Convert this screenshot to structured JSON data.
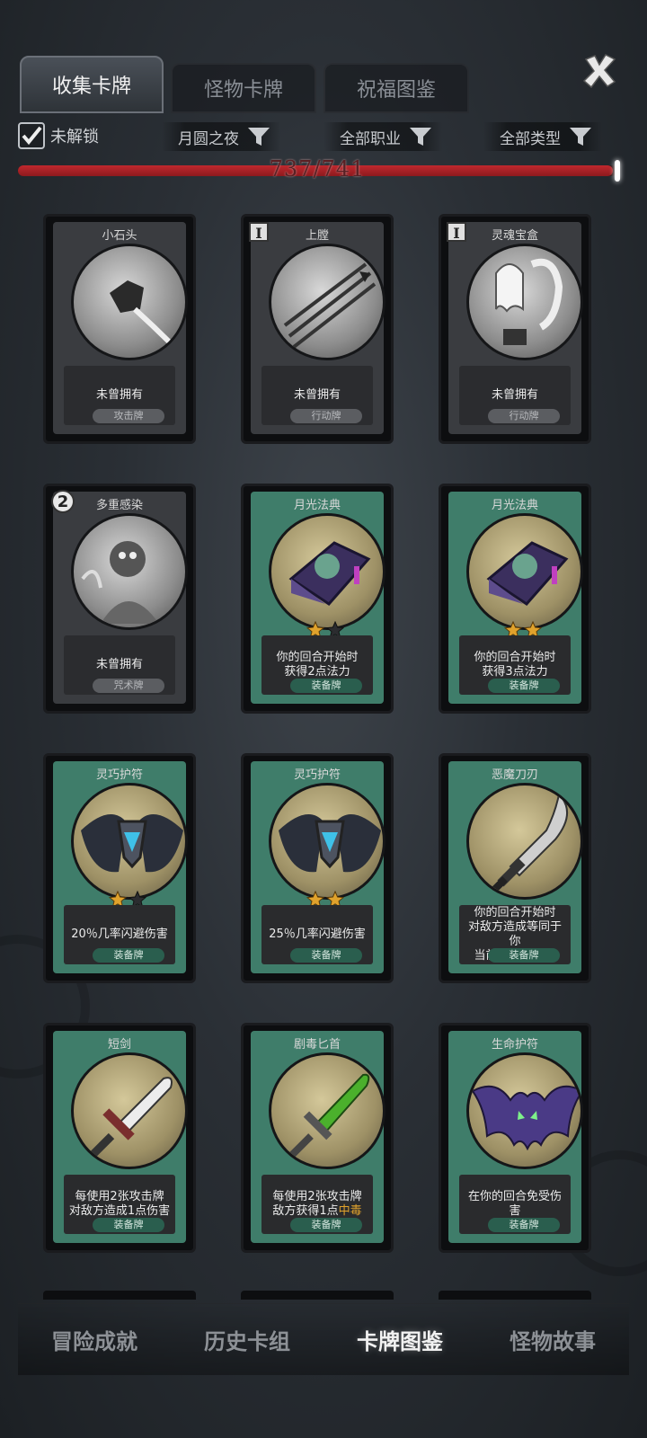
{
  "tabs": [
    {
      "label": "收集卡牌",
      "active": true
    },
    {
      "label": "怪物卡牌",
      "active": false
    },
    {
      "label": "祝福图鉴",
      "active": false
    }
  ],
  "close_icon": "close-x-icon",
  "filters": {
    "unlocked_checked": true,
    "unlocked_label": "未解锁",
    "dropdowns": [
      "月圆之夜",
      "全部职业",
      "全部类型"
    ]
  },
  "progress": {
    "text": "737/741",
    "current": 737,
    "total": 741
  },
  "cards": [
    {
      "title": "小石头",
      "desc": "未曾拥有",
      "type": "攻击牌",
      "style": "gray",
      "badge": null,
      "stars": null,
      "art": "rock"
    },
    {
      "title": "上膛",
      "desc": "未曾拥有",
      "type": "行动牌",
      "style": "gray",
      "badge": "I",
      "stars": null,
      "art": "arrows"
    },
    {
      "title": "灵魂宝盒",
      "desc": "未曾拥有",
      "type": "行动牌",
      "style": "gray",
      "badge": "I",
      "stars": null,
      "art": "ghost"
    },
    {
      "title": "多重感染",
      "desc": "未曾拥有",
      "type": "咒术牌",
      "style": "gray",
      "badge": "2",
      "stars": null,
      "art": "monster"
    },
    {
      "title": "月光法典",
      "desc": "你的回合开始时\n获得2点法力",
      "type": "装备牌",
      "style": "green",
      "badge": null,
      "stars": 1,
      "art": "book"
    },
    {
      "title": "月光法典",
      "desc": "你的回合开始时\n获得3点法力",
      "type": "装备牌",
      "style": "green",
      "badge": null,
      "stars": 2,
      "art": "book"
    },
    {
      "title": "灵巧护符",
      "desc": "20％几率闪避伤害",
      "type": "装备牌",
      "style": "green",
      "badge": null,
      "stars": 1,
      "art": "amulet"
    },
    {
      "title": "灵巧护符",
      "desc": "25％几率闪避伤害",
      "type": "装备牌",
      "style": "green",
      "badge": null,
      "stars": 2,
      "art": "amulet"
    },
    {
      "title": "恶魔刀刃",
      "desc": "你的回合开始时\n对敌方造成等同于你\n当前等级的伤害",
      "type": "装备牌",
      "style": "green",
      "badge": null,
      "stars": null,
      "art": "sword"
    },
    {
      "title": "短剑",
      "desc": "每使用2张攻击牌\n对敌方造成1点伤害",
      "type": "装备牌",
      "style": "green",
      "badge": null,
      "stars": null,
      "art": "dagger"
    },
    {
      "title": "剧毒匕首",
      "desc": "每使用2张攻击牌\n敌方获得1点",
      "desc_highlight": "中毒",
      "type": "装备牌",
      "style": "green",
      "badge": null,
      "stars": null,
      "art": "poison-dagger"
    },
    {
      "title": "生命护符",
      "desc": "在你的回合免受伤害",
      "type": "装备牌",
      "style": "green",
      "badge": null,
      "stars": null,
      "art": "bat"
    }
  ],
  "bottom_nav": [
    {
      "label": "冒险成就",
      "active": false
    },
    {
      "label": "历史卡组",
      "active": false
    },
    {
      "label": "卡牌图鉴",
      "active": true
    },
    {
      "label": "怪物故事",
      "active": false
    }
  ],
  "colors": {
    "progress_red": "#c0282e",
    "card_green": "#3f7d6a",
    "star_gold": "#e0a22c"
  }
}
